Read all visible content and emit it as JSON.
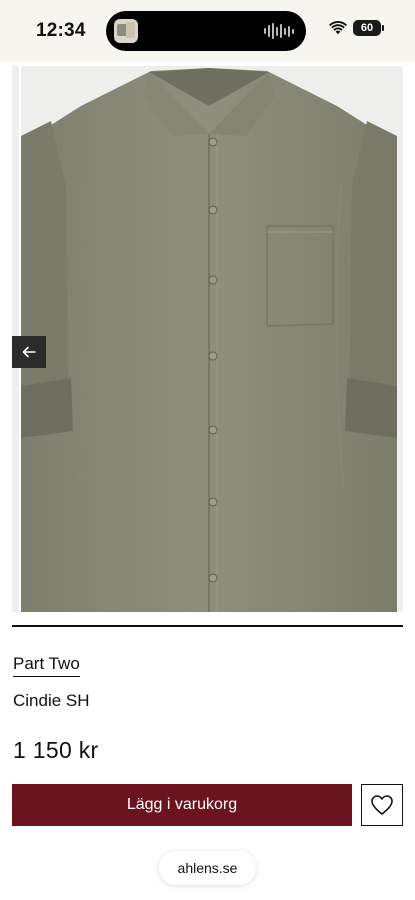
{
  "status_bar": {
    "time": "12:34",
    "battery": "60",
    "icons": [
      "wifi-icon",
      "battery-icon",
      "audio-wave-icon"
    ]
  },
  "gallery": {
    "image_subject": "olive-green-linen-shirt",
    "shirt_color": "#8d8d7b",
    "prev_icon": "arrow-left-icon"
  },
  "product": {
    "brand": "Part Two",
    "name": "Cindie SH",
    "price": "1 150 kr"
  },
  "actions": {
    "add_to_cart_label": "Lägg i varukorg",
    "add_to_cart_color": "#6b1420",
    "wishlist_icon": "heart-icon"
  },
  "browser": {
    "url": "ahlens.se"
  }
}
